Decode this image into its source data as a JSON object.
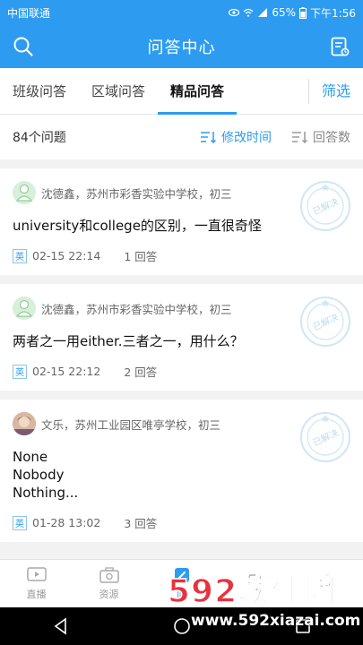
{
  "statusbar": {
    "carrier": "中国联通",
    "battery": "65%",
    "time": "下午1:56"
  },
  "appbar": {
    "title": "问答中心"
  },
  "tabs": [
    {
      "label": "班级问答"
    },
    {
      "label": "区域问答"
    },
    {
      "label": "精品问答"
    }
  ],
  "filter_label": "筛选",
  "sortbar": {
    "count": "84个问题",
    "sort_time": "修改时间",
    "sort_answers": "回答数"
  },
  "questions": [
    {
      "author": "沈德鑫，苏州市彩香实验中学校，初三",
      "text": "university和college的区别，一直很奇怪",
      "subject": "英",
      "time": "02-15 22:14",
      "answers": "1 回答",
      "stamp": "已解决"
    },
    {
      "author": "沈德鑫，苏州市彩香实验中学校，初三",
      "text": "两者之一用either.三者之一，用什么？",
      "subject": "英",
      "time": "02-15 22:12",
      "answers": "2 回答",
      "stamp": "已解决"
    },
    {
      "author": "文乐，苏州工业园区唯亭学校，初三",
      "text": "None\nNobody\nNothing...",
      "subject": "英",
      "time": "01-28 13:02",
      "answers": "3 回答",
      "stamp": "已解决"
    }
  ],
  "bottomnav": [
    {
      "label": "直播",
      "icon": "live-icon"
    },
    {
      "label": "资源",
      "icon": "resource-icon"
    },
    {
      "label": "问",
      "icon": "qa-icon"
    },
    {
      "label": "",
      "icon": "notebook-icon"
    },
    {
      "label": "",
      "icon": "profile-icon"
    }
  ],
  "watermark": {
    "brand": "592软件园",
    "url": "www.592xiazai.com"
  },
  "colors": {
    "primary": "#2d9cf0",
    "watermark": "#e8323c"
  }
}
